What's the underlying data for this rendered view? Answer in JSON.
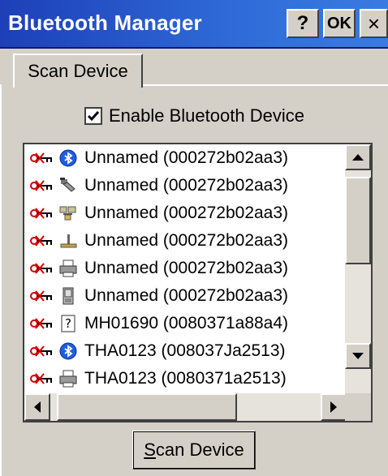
{
  "window": {
    "title": "Bluetooth Manager",
    "help_label": "?",
    "ok_label": "OK",
    "close_label": "×"
  },
  "tabs": [
    {
      "label": "Scan Device",
      "selected": true
    }
  ],
  "enable_checkbox": {
    "label": "Enable Bluetooth Device",
    "checked": true
  },
  "devices": [
    {
      "icon": "bluetooth-icon",
      "label": "Unnamed (000272b02aa3)"
    },
    {
      "icon": "scanner-icon",
      "label": "Unnamed (000272b02aa3)"
    },
    {
      "icon": "network-icon",
      "label": "Unnamed (000272b02aa3)"
    },
    {
      "icon": "joystick-icon",
      "label": "Unnamed (000272b02aa3)"
    },
    {
      "icon": "printer-icon",
      "label": "Unnamed (000272b02aa3)"
    },
    {
      "icon": "pda-icon",
      "label": "Unnamed (000272b02aa3)"
    },
    {
      "icon": "unknown-device-icon",
      "label": "MH01690 (0080371a88a4)"
    },
    {
      "icon": "bluetooth-icon",
      "label": "THA0123 (008037Ja2513)"
    },
    {
      "icon": "printer-icon",
      "label": "THA0123 (0080371a2513)"
    }
  ],
  "scan_button": {
    "label": "Scan Device",
    "underline_char": "S"
  },
  "colors": {
    "titlebar": "#2f6bd8",
    "face": "#d4d0c8",
    "key_red": "#d00000"
  }
}
